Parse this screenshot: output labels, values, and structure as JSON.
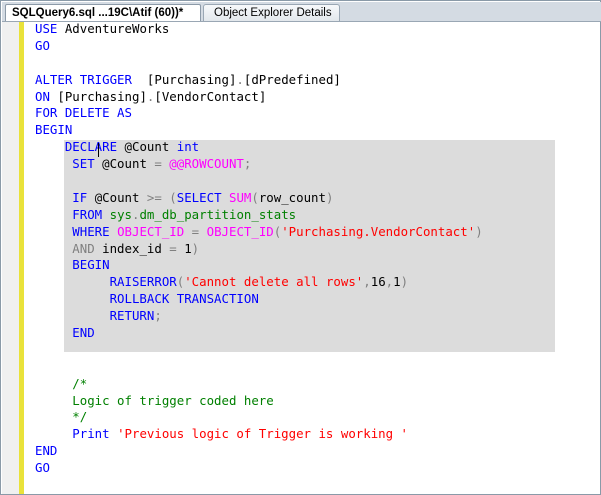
{
  "tabs": [
    {
      "label": "SQLQuery6.sql ...19C\\Atif (60))*"
    },
    {
      "label": "Object Explorer Details"
    }
  ],
  "editor": {
    "lines": [
      [
        {
          "t": "USE ",
          "c": "kw"
        },
        {
          "t": "AdventureWorks"
        }
      ],
      [
        {
          "t": "GO",
          "c": "kw"
        }
      ],
      [],
      [
        {
          "t": "ALTER TRIGGER",
          "c": "kw"
        },
        {
          "t": "  [Purchasing]"
        },
        {
          "t": ".",
          "c": "gr"
        },
        {
          "t": "[dPredefined]"
        }
      ],
      [
        {
          "t": "ON ",
          "c": "kw"
        },
        {
          "t": "[Purchasing]"
        },
        {
          "t": ".",
          "c": "gr"
        },
        {
          "t": "[VendorContact]"
        }
      ],
      [
        {
          "t": "FOR DELETE AS",
          "c": "kw"
        }
      ],
      [
        {
          "t": "BEGIN",
          "c": "kw"
        }
      ],
      [
        {
          "t": "    DECLARE ",
          "c": "kw"
        },
        {
          "t": "@Count "
        },
        {
          "t": "int",
          "c": "kw"
        }
      ],
      [
        {
          "t": "     SET ",
          "c": "kw"
        },
        {
          "t": "@Count "
        },
        {
          "t": "=",
          "c": "gr"
        },
        {
          "t": " "
        },
        {
          "t": "@@ROWCOUNT",
          "c": "fn"
        },
        {
          "t": ";",
          "c": "gr"
        }
      ],
      [],
      [
        {
          "t": "     IF ",
          "c": "kw"
        },
        {
          "t": "@Count "
        },
        {
          "t": ">=",
          "c": "gr"
        },
        {
          "t": " "
        },
        {
          "t": "(",
          "c": "gr"
        },
        {
          "t": "SELECT ",
          "c": "kw"
        },
        {
          "t": "SUM",
          "c": "fn"
        },
        {
          "t": "(",
          "c": "gr"
        },
        {
          "t": "row_count"
        },
        {
          "t": ")",
          "c": "gr"
        }
      ],
      [
        {
          "t": "     FROM ",
          "c": "kw"
        },
        {
          "t": "sys",
          "c": "cm"
        },
        {
          "t": ".",
          "c": "gr"
        },
        {
          "t": "dm_db_partition_stats",
          "c": "cm"
        }
      ],
      [
        {
          "t": "     WHERE ",
          "c": "kw"
        },
        {
          "t": "OBJECT_ID",
          "c": "fn"
        },
        {
          "t": " "
        },
        {
          "t": "=",
          "c": "gr"
        },
        {
          "t": " "
        },
        {
          "t": "OBJECT_ID",
          "c": "fn"
        },
        {
          "t": "(",
          "c": "gr"
        },
        {
          "t": "'Purchasing.VendorContact'",
          "c": "str"
        },
        {
          "t": ")",
          "c": "gr"
        }
      ],
      [
        {
          "t": "     AND ",
          "c": "gr"
        },
        {
          "t": "index_id "
        },
        {
          "t": "=",
          "c": "gr"
        },
        {
          "t": " 1"
        },
        {
          "t": ")",
          "c": "gr"
        }
      ],
      [
        {
          "t": "     BEGIN",
          "c": "kw"
        }
      ],
      [
        {
          "t": "          RAISERROR",
          "c": "kw"
        },
        {
          "t": "(",
          "c": "gr"
        },
        {
          "t": "'Cannot delete all rows'",
          "c": "str"
        },
        {
          "t": ",",
          "c": "gr"
        },
        {
          "t": "16"
        },
        {
          "t": ",",
          "c": "gr"
        },
        {
          "t": "1"
        },
        {
          "t": ")",
          "c": "gr"
        }
      ],
      [
        {
          "t": "          ROLLBACK TRANSACTION",
          "c": "kw"
        }
      ],
      [
        {
          "t": "          RETURN",
          "c": "kw"
        },
        {
          "t": ";",
          "c": "gr"
        }
      ],
      [
        {
          "t": "     END",
          "c": "kw"
        }
      ],
      [],
      [],
      [
        {
          "t": "     /*",
          "c": "cm"
        }
      ],
      [
        {
          "t": "     Logic of trigger coded here",
          "c": "cm"
        }
      ],
      [
        {
          "t": "     */",
          "c": "cm"
        }
      ],
      [
        {
          "t": "     Print ",
          "c": "kw"
        },
        {
          "t": "'Previous logic of Trigger is working '",
          "c": "str"
        }
      ],
      [
        {
          "t": "END",
          "c": "kw"
        }
      ],
      [
        {
          "t": "GO",
          "c": "kw"
        }
      ]
    ]
  },
  "colors": {
    "keyword": "#0000ff",
    "string": "#ff0000",
    "function": "#ff00ff",
    "operator": "#808080",
    "comment": "#008000",
    "selection": "#dcdcdc",
    "change_margin": "#e9e23a"
  }
}
